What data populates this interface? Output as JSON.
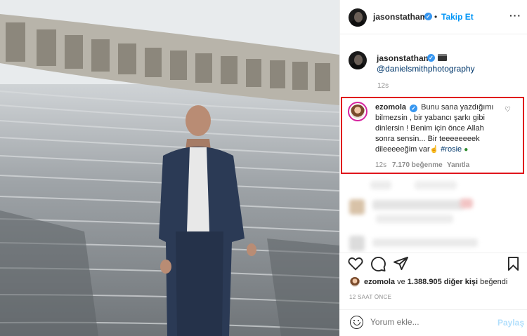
{
  "header": {
    "username": "jasonstatham",
    "verified_icon": "verified-badge-icon",
    "separator": "•",
    "follow_label": "Takip Et",
    "more_icon": "more-options-icon"
  },
  "caption": {
    "username": "jasonstatham",
    "mention": "@danielsmithphotography",
    "time": "12s"
  },
  "highlight_color": "#e0151c",
  "comment": {
    "username": "ezomola",
    "line1": "Bunu sana yazdığımı",
    "line2": "bilmezsin , bir yabancı şarkı gibi",
    "line3": "dinlersin ! Benim için önce Allah",
    "line4": "sonra sensin... Bir teeeeeeeek",
    "line5_text": "dileeeeeğim var",
    "hashtag": "#rosie",
    "time": "12s",
    "likes": "7.170 beğenme",
    "reply": "Yanıtla"
  },
  "likes_line": {
    "user": "ezomola",
    "connector": "ve",
    "count": "1.388.905 diğer kişi",
    "suffix": "beğendi"
  },
  "timestamp": "12 SAAT ÖNCE",
  "comment_input": {
    "placeholder": "Yorum ekle...",
    "post_label": "Paylaş"
  },
  "icons": {
    "like": "heart-icon",
    "comment": "comment-icon",
    "share": "share-icon",
    "save": "bookmark-icon",
    "emoji": "emoji-icon"
  }
}
